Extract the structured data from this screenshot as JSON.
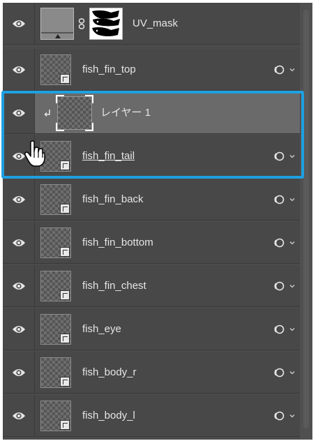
{
  "layers_panel": {
    "layers": [
      {
        "name": "UV_mask",
        "visible": true,
        "thumbnail": "gray-fill-with-mask",
        "has_link_icon": false
      },
      {
        "name": "fish_fin_top",
        "visible": true,
        "thumbnail": "smart-object",
        "has_link_icon": true
      },
      {
        "name": "レイヤー 1",
        "visible": true,
        "thumbnail": "clipping-layer",
        "has_link_icon": false
      },
      {
        "name": "fish_fin_tail",
        "visible": true,
        "thumbnail": "smart-object",
        "has_link_icon": true
      },
      {
        "name": "fish_fin_back",
        "visible": true,
        "thumbnail": "smart-object",
        "has_link_icon": true
      },
      {
        "name": "fish_fin_bottom",
        "visible": true,
        "thumbnail": "smart-object",
        "has_link_icon": true
      },
      {
        "name": "fish_fin_chest",
        "visible": true,
        "thumbnail": "smart-object",
        "has_link_icon": true
      },
      {
        "name": "fish_eye",
        "visible": true,
        "thumbnail": "smart-object",
        "has_link_icon": true
      },
      {
        "name": "fish_body_r",
        "visible": true,
        "thumbnail": "smart-object",
        "has_link_icon": true
      },
      {
        "name": "fish_body_l",
        "visible": true,
        "thumbnail": "smart-object",
        "has_link_icon": true
      }
    ],
    "selected_layer": "レイヤー 1",
    "icons": {
      "visibility": "eye-icon",
      "link": "link-layer-icon",
      "chain": "chain-icon",
      "clip": "clipping-arrow-icon",
      "expand": "chevron-down-icon",
      "cursor": "hand-pointer-icon"
    }
  },
  "colors": {
    "panel_bg": "#484848",
    "selected_bg": "#6a6a6a",
    "text": "#e6e6e6",
    "highlight": "#1ea0e0"
  }
}
